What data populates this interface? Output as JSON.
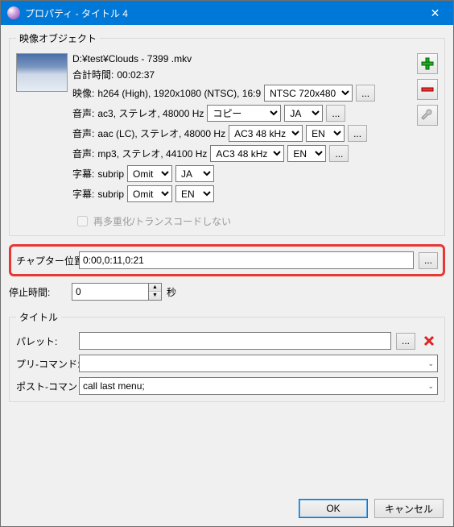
{
  "window": {
    "title": "プロパティ - タイトル 4",
    "close": "✕"
  },
  "video_group": {
    "legend": "映像オブジェクト",
    "file_path": "D:¥test¥Clouds - 7399 .mkv",
    "total_label": "合計時間:",
    "total_time": "00:02:37",
    "v_label": "映像:",
    "v_info": "h264 (High), 1920x1080 (NTSC), 16:9",
    "v_preset": "NTSC 720x480",
    "a1_label": "音声:",
    "a1_info": "ac3, ステレオ, 48000 Hz",
    "a1_codec": "コピー",
    "a1_lang": "JA",
    "a2_label": "音声:",
    "a2_info": "aac (LC), ステレオ, 48000 Hz",
    "a2_codec": "AC3 48 kHz",
    "a2_lang": "EN",
    "a3_label": "音声:",
    "a3_info": "mp3, ステレオ, 44100 Hz",
    "a3_codec": "AC3 48 kHz",
    "a3_lang": "EN",
    "s1_label": "字幕:",
    "s1_info": "subrip",
    "s1_mode": "Omit",
    "s1_lang": "JA",
    "s2_label": "字幕:",
    "s2_info": "subrip",
    "s2_mode": "Omit",
    "s2_lang": "EN",
    "remux_label": "再多重化/トランスコードしない"
  },
  "chapter": {
    "label": "チャプター位置:",
    "value": "0:00,0:11,0:21"
  },
  "pause": {
    "label": "停止時間:",
    "value": "0",
    "unit": "秒"
  },
  "title_group": {
    "legend": "タイトル",
    "palette_label": "パレット:",
    "palette_value": "",
    "pre_label": "プリ-コマンド:",
    "pre_value": "",
    "post_label": "ポスト-コマンド:",
    "post_value": "call last menu;"
  },
  "buttons": {
    "ok": "OK",
    "cancel": "キャンセル",
    "dots": "..."
  },
  "icons": {
    "combo_arrow": "⌄"
  }
}
